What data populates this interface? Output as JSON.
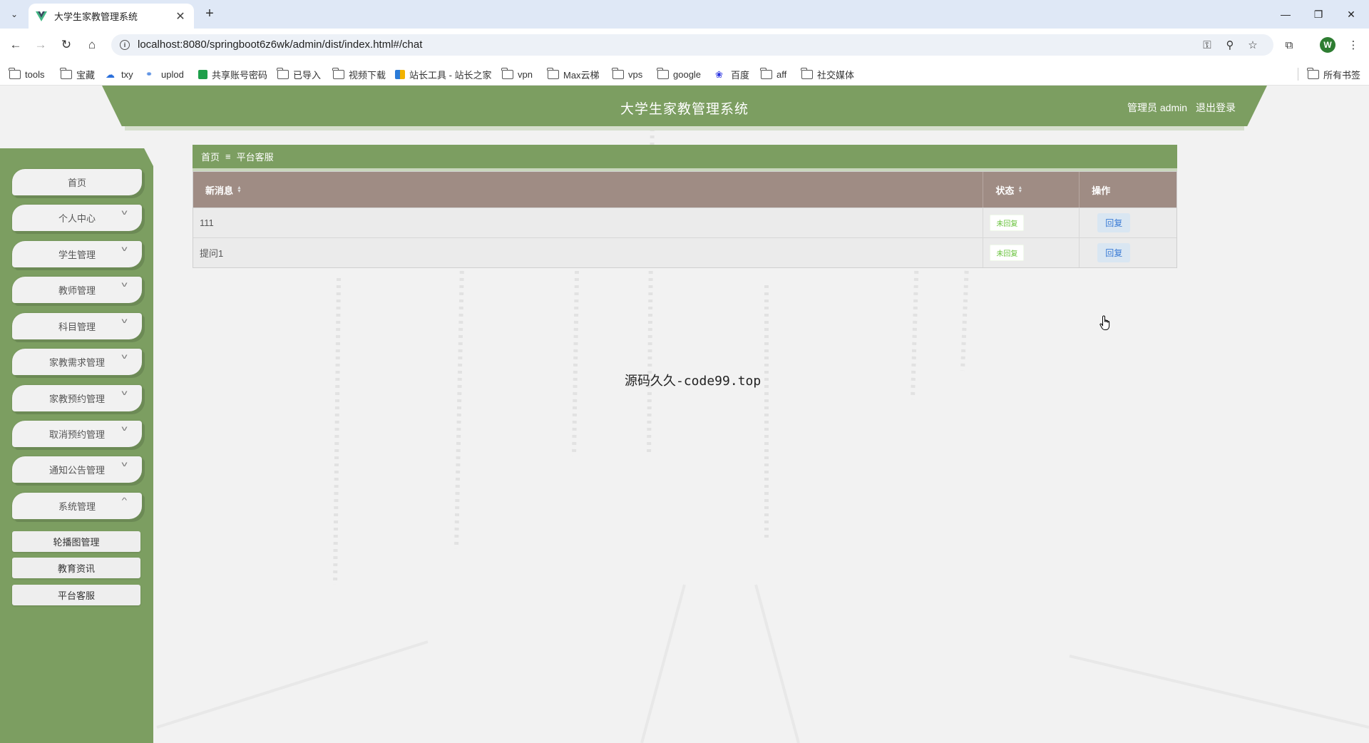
{
  "browser": {
    "tab_title": "大学生家教管理系统",
    "tab_close": "✕",
    "new_tab": "+",
    "url": "localhost:8080/springboot6z6wk/admin/dist/index.html#/chat",
    "profile_initial": "W",
    "bookmarks": [
      {
        "label": "tools",
        "icon": "folder-icon"
      },
      {
        "label": "宝藏",
        "icon": "folder-icon"
      },
      {
        "label": "txy",
        "icon": "cloud-icon"
      },
      {
        "label": "uplod",
        "icon": "link-icon"
      },
      {
        "label": "共享账号密码",
        "icon": "sheet-icon"
      },
      {
        "label": "已导入",
        "icon": "folder-icon"
      },
      {
        "label": "视频下载",
        "icon": "folder-icon"
      },
      {
        "label": "站长工具 - 站长之家",
        "icon": "site-icon"
      },
      {
        "label": "vpn",
        "icon": "folder-icon"
      },
      {
        "label": "Max云梯",
        "icon": "folder-icon"
      },
      {
        "label": "vps",
        "icon": "folder-icon"
      },
      {
        "label": "google",
        "icon": "folder-icon"
      },
      {
        "label": "百度",
        "icon": "baidu-icon"
      },
      {
        "label": "aff",
        "icon": "folder-icon"
      },
      {
        "label": "社交媒体",
        "icon": "folder-icon"
      }
    ],
    "all_bookmarks": "所有书签"
  },
  "header": {
    "title": "大学生家教管理系统",
    "user": "管理员 admin",
    "logout": "退出登录"
  },
  "sidebar": {
    "items": [
      {
        "label": "首页",
        "expandable": false
      },
      {
        "label": "个人中心",
        "expandable": true
      },
      {
        "label": "学生管理",
        "expandable": true
      },
      {
        "label": "教师管理",
        "expandable": true
      },
      {
        "label": "科目管理",
        "expandable": true
      },
      {
        "label": "家教需求管理",
        "expandable": true
      },
      {
        "label": "家教预约管理",
        "expandable": true
      },
      {
        "label": "取消预约管理",
        "expandable": true
      },
      {
        "label": "通知公告管理",
        "expandable": true
      },
      {
        "label": "系统管理",
        "expandable": true,
        "expanded": true
      }
    ],
    "submenu": [
      {
        "label": "轮播图管理"
      },
      {
        "label": "教育资讯"
      },
      {
        "label": "平台客服"
      }
    ]
  },
  "breadcrumb": {
    "home": "首页",
    "separator": "≡",
    "current": "平台客服"
  },
  "table": {
    "columns": [
      "新消息",
      "状态",
      "操作"
    ],
    "rows": [
      {
        "message": "111",
        "status": "未回复",
        "action": "回复"
      },
      {
        "message": "提问1",
        "status": "未回复",
        "action": "回复"
      }
    ]
  },
  "watermark": "源码久久-code99.top",
  "colors": {
    "primary": "#7c9e61",
    "table_header": "#9f8c84",
    "status_green": "#67c23a",
    "reply_blue": "#3a7bd5"
  }
}
